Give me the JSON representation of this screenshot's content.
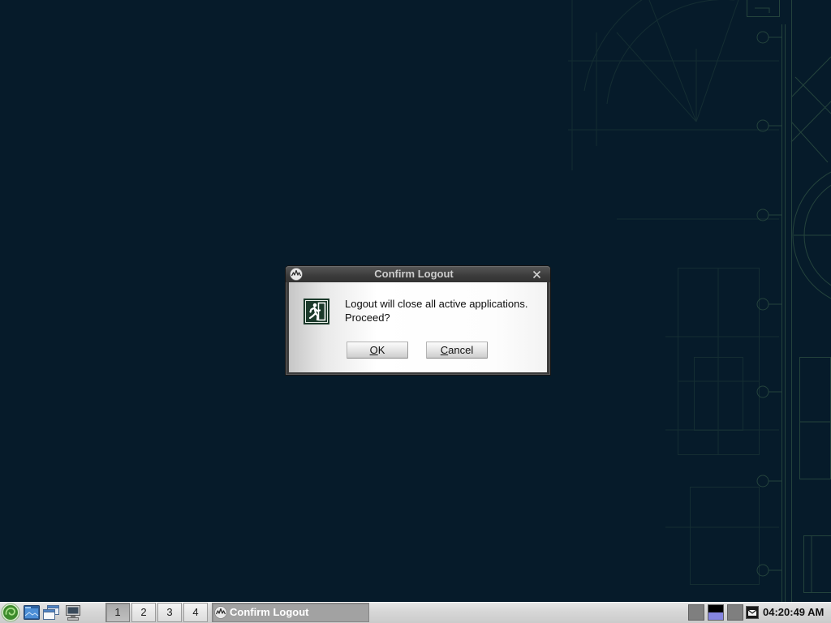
{
  "theme": {
    "desktop_background": "#061b2a",
    "wallpaper_lines": "#2a4a40",
    "titlebar_text": "#cdcdcd",
    "active_task_background": "#a2a2a2",
    "cpu_graph_fill": "#8585e0"
  },
  "dialog": {
    "title": "Confirm Logout",
    "title_icon": "app-logo-icon",
    "close_icon": "close-icon",
    "message_icon": "exit-icon",
    "message_lines": [
      "Logout will close all active applications.",
      "Proceed?"
    ],
    "buttons": [
      {
        "label": "OK"
      },
      {
        "label": "Cancel"
      }
    ]
  },
  "taskbar": {
    "launchers": [
      {
        "icon": "main-menu-icon"
      },
      {
        "icon": "file-manager-icon"
      },
      {
        "icon": "windows-icon"
      },
      {
        "icon": "computer-icon"
      }
    ],
    "desktops": [
      {
        "label": "1"
      },
      {
        "label": "2"
      },
      {
        "label": "3"
      },
      {
        "label": "4"
      }
    ],
    "active_desktop_index": 0,
    "tasks": [
      {
        "label": "Confirm Logout",
        "icon": "app-logo-icon",
        "active": true
      }
    ],
    "tray": {
      "items": [
        {
          "widget": "tray-indicator"
        },
        {
          "widget": "cpu-monitor-graph",
          "level": 0.5
        },
        {
          "widget": "tray-indicator"
        },
        {
          "widget": "envelope-icon"
        }
      ]
    },
    "clock": "04:20:49 AM"
  }
}
